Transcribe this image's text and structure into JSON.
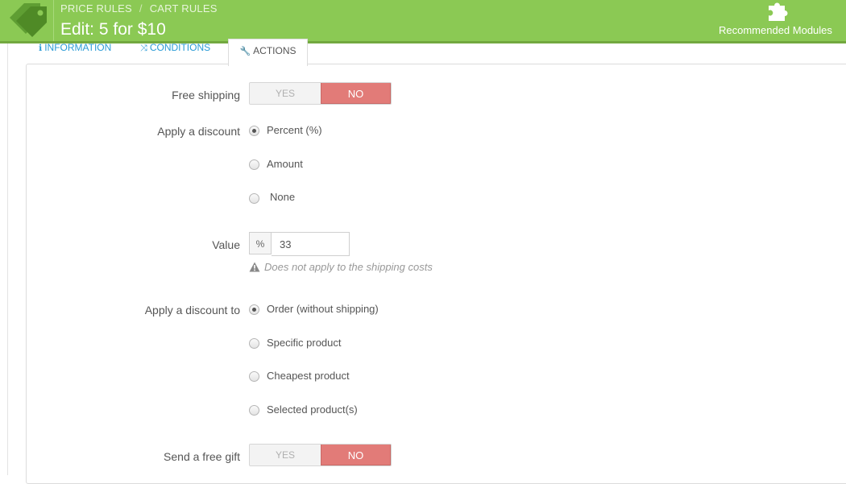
{
  "header": {
    "breadcrumb": [
      "PRICE RULES",
      "CART RULES"
    ],
    "breadcrumb_sep": "/",
    "title": "Edit: 5 for $10",
    "recommended_modules": "Recommended Modules",
    "colors": {
      "bar": "#8bc954",
      "accent_no": "#e27b78"
    }
  },
  "tabs": [
    {
      "label": "INFORMATION",
      "icon": "info-icon"
    },
    {
      "label": "CONDITIONS",
      "icon": "shuffle-icon"
    },
    {
      "label": "ACTIONS",
      "icon": "wrench-icon",
      "active": true
    }
  ],
  "form": {
    "free_shipping": {
      "label": "Free shipping",
      "yes": "YES",
      "no": "NO",
      "selected": "NO"
    },
    "apply_discount": {
      "label": "Apply a discount",
      "options": [
        "Percent (%)",
        "Amount",
        "None"
      ],
      "selected": "Percent (%)"
    },
    "value": {
      "label": "Value",
      "prefix": "%",
      "value": "33",
      "hint": "Does not apply to the shipping costs"
    },
    "apply_discount_to": {
      "label": "Apply a discount to",
      "options": [
        "Order (without shipping)",
        "Specific product",
        "Cheapest product",
        "Selected product(s)"
      ],
      "selected": "Order (without shipping)"
    },
    "free_gift": {
      "label": "Send a free gift",
      "yes": "YES",
      "no": "NO",
      "selected": "NO"
    }
  }
}
